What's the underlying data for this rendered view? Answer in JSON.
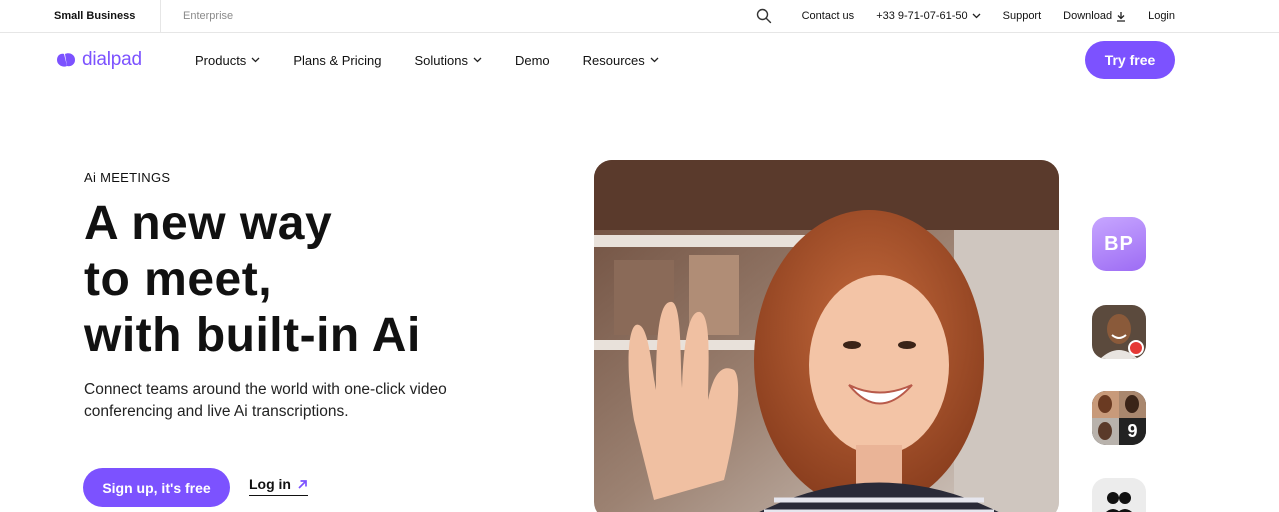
{
  "utility_bar": {
    "segment_small": "Small Business",
    "segment_enterprise": "Enterprise",
    "contact": "Contact us",
    "phone": "+33 9-71-07-61-50",
    "support": "Support",
    "download": "Download",
    "login": "Login"
  },
  "nav": {
    "logo_text": "dialpad",
    "items": [
      {
        "label": "Products"
      },
      {
        "label": "Plans & Pricing"
      },
      {
        "label": "Solutions"
      },
      {
        "label": "Demo"
      },
      {
        "label": "Resources"
      }
    ],
    "cta": "Try free"
  },
  "hero": {
    "eyebrow": "Ai MEETINGS",
    "headline": [
      "A new way",
      "to meet,",
      "with built-in Ai"
    ],
    "subtext": "Connect teams around the world with one-click video conferencing and live Ai transcriptions.",
    "primary_cta": "Sign up, it's free",
    "secondary_cta": "Log in"
  },
  "participants": {
    "initials": "BP",
    "group_count": "9"
  },
  "colors": {
    "brand": "#7c52ff",
    "record": "#e53935"
  }
}
